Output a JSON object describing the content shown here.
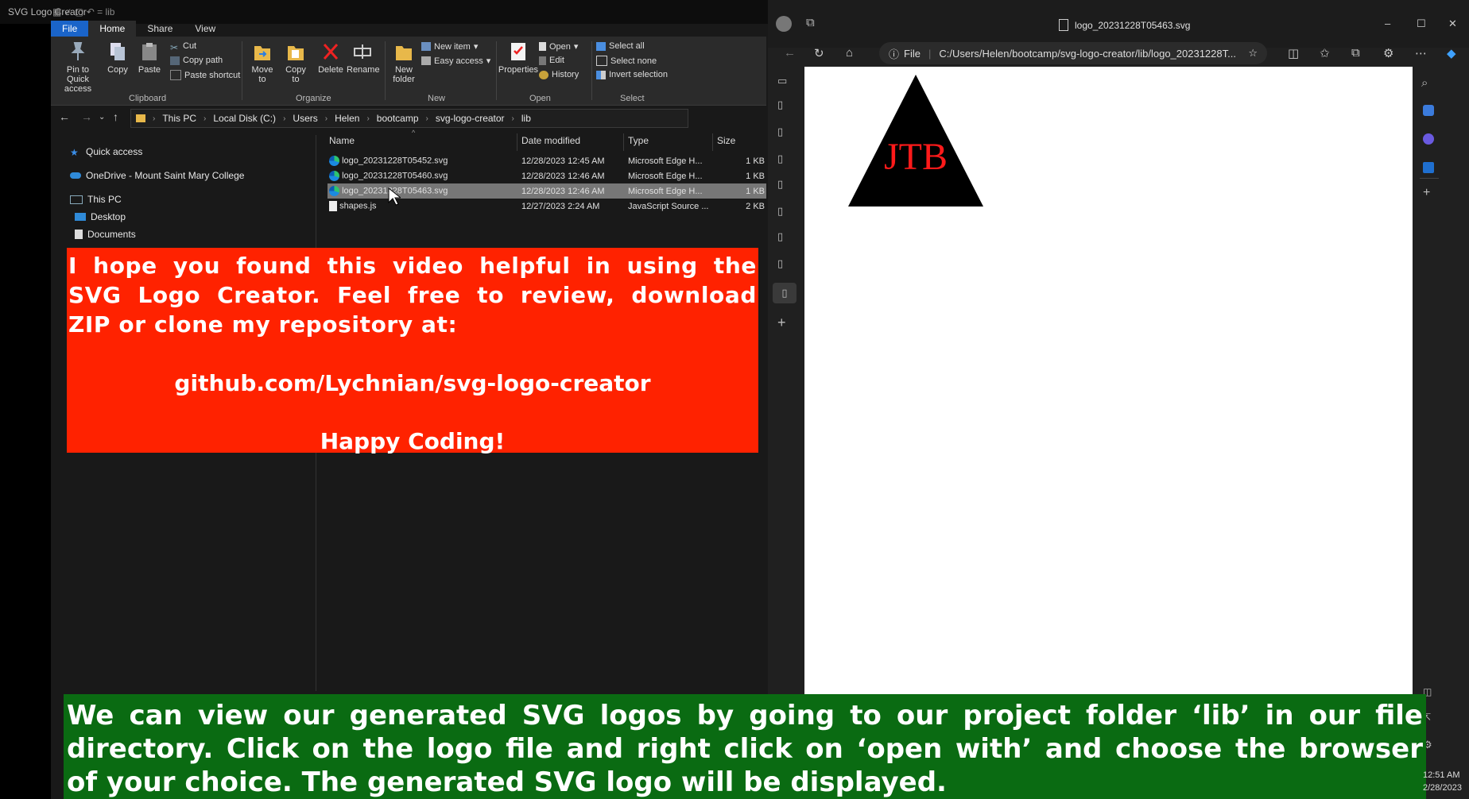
{
  "explorer": {
    "title": "SVG Logo Creator",
    "qat_path": "lib",
    "tabs": [
      "File",
      "Home",
      "Share",
      "View"
    ],
    "ribbon": {
      "clipboard": {
        "pin": "Pin to Quick access",
        "copy": "Copy",
        "paste": "Paste",
        "cut": "Cut",
        "copy_path": "Copy path",
        "paste_shortcut": "Paste shortcut",
        "group": "Clipboard"
      },
      "organize": {
        "move_to": "Move to",
        "copy_to": "Copy to",
        "delete": "Delete",
        "rename": "Rename",
        "group": "Organize"
      },
      "new": {
        "new_folder": "New folder",
        "new_item": "New item",
        "easy_access": "Easy access",
        "group": "New"
      },
      "open": {
        "properties": "Properties",
        "open": "Open",
        "edit": "Edit",
        "history": "History",
        "group": "Open"
      },
      "select": {
        "select_all": "Select all",
        "select_none": "Select none",
        "invert": "Invert selection",
        "group": "Select"
      }
    },
    "breadcrumbs": [
      "This PC",
      "Local Disk (C:)",
      "Users",
      "Helen",
      "bootcamp",
      "svg-logo-creator",
      "lib"
    ],
    "nav": {
      "quick_access": "Quick access",
      "onedrive": "OneDrive - Mount Saint Mary College",
      "this_pc": "This PC",
      "desktop": "Desktop",
      "documents": "Documents"
    },
    "columns": {
      "name": "Name",
      "date": "Date modified",
      "type": "Type",
      "size": "Size"
    },
    "files": [
      {
        "name": "logo_20231228T05452.svg",
        "date": "12/28/2023 12:45 AM",
        "type": "Microsoft Edge H...",
        "size": "1 KB",
        "icon": "edge-icon"
      },
      {
        "name": "logo_20231228T05460.svg",
        "date": "12/28/2023 12:46 AM",
        "type": "Microsoft Edge H...",
        "size": "1 KB",
        "icon": "edge-icon"
      },
      {
        "name": "logo_20231228T05463.svg",
        "date": "12/28/2023 12:46 AM",
        "type": "Microsoft Edge H...",
        "size": "1 KB",
        "icon": "edge-icon",
        "selected": true
      },
      {
        "name": "shapes.js",
        "date": "12/27/2023 2:24 AM",
        "type": "JavaScript Source ...",
        "size": "2 KB",
        "icon": "js-file-icon"
      }
    ]
  },
  "browser": {
    "tab_title": "logo_20231228T05463.svg",
    "url_scheme": "File",
    "url": "C:/Users/Helen/bootcamp/svg-logo-creator/lib/logo_20231228T...",
    "logo": {
      "text": "JTB",
      "shape": "triangle",
      "shape_color": "#000000",
      "text_color": "#ff1a1a"
    }
  },
  "overlays": {
    "red": {
      "lines": [
        "I hope you found this video helpful in using the",
        "SVG Logo Creator. Feel free to review, download",
        "ZIP or  clone my repository at:"
      ],
      "link": "github.com/Lychnian/svg-logo-creator",
      "signoff": "Happy Coding!"
    },
    "green": {
      "lines": [
        "We can view our generated SVG logos by going to our project folder ‘lib’ in our file",
        "directory. Click on the logo file and right click on ‘open with’ and choose the browser",
        "of your choice. The generated SVG logo will be displayed."
      ]
    }
  },
  "taskbar": {
    "time": "12:51 AM",
    "date": "2/28/2023"
  }
}
